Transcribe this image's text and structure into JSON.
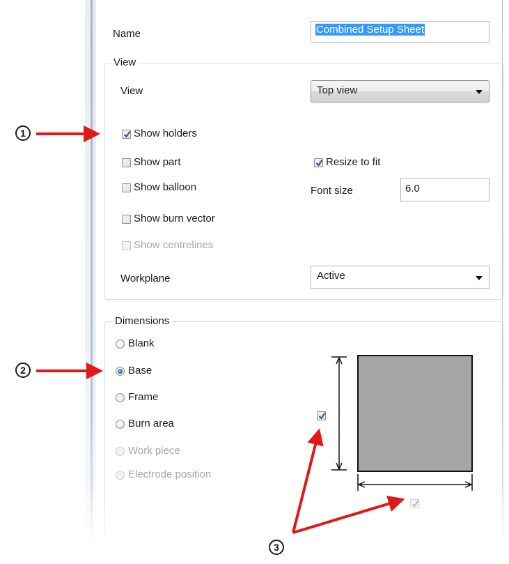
{
  "name_field": {
    "label": "Name",
    "value": "Combined Setup Sheet"
  },
  "view_group": {
    "legend": "View",
    "view_label": "View",
    "view_value": "Top view",
    "checkboxes": [
      {
        "label": "Show holders",
        "checked": true,
        "enabled": true
      },
      {
        "label": "Show part",
        "checked": false,
        "enabled": true
      },
      {
        "label": "Show balloon",
        "checked": false,
        "enabled": true
      },
      {
        "label": "Show burn vector",
        "checked": false,
        "enabled": true
      },
      {
        "label": "Show centrelines",
        "checked": false,
        "enabled": false
      }
    ],
    "resize_to_fit": {
      "label": "Resize to fit",
      "checked": true
    },
    "font_size": {
      "label": "Font size",
      "value": "6.0"
    },
    "workplane": {
      "label": "Workplane",
      "value": "Active"
    }
  },
  "dimensions_group": {
    "legend": "Dimensions",
    "radios": [
      {
        "label": "Blank",
        "selected": false,
        "enabled": true
      },
      {
        "label": "Base",
        "selected": true,
        "enabled": true
      },
      {
        "label": "Frame",
        "selected": false,
        "enabled": true
      },
      {
        "label": "Burn area",
        "selected": false,
        "enabled": true
      },
      {
        "label": "Work piece",
        "selected": false,
        "enabled": false
      },
      {
        "label": "Electrode position",
        "selected": false,
        "enabled": false
      }
    ],
    "vertical_dimension_checked": true,
    "horizontal_dimension_checked": true
  },
  "callouts": [
    "1",
    "2",
    "3"
  ],
  "colors": {
    "arrow_red": "#e01818",
    "selection_blue": "#3399ff",
    "preview_fill": "#a6a6a6"
  }
}
